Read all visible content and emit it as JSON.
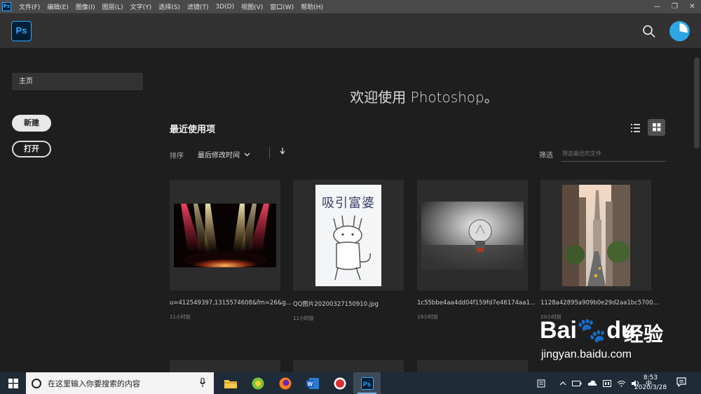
{
  "menubar": {
    "app_icon": "Ps",
    "items": [
      "文件(F)",
      "编辑(E)",
      "图像(I)",
      "图层(L)",
      "文字(Y)",
      "选择(S)",
      "滤镜(T)",
      "3D(D)",
      "视图(V)",
      "窗口(W)",
      "帮助(H)"
    ],
    "window_controls": [
      "—",
      "❐",
      "✕"
    ]
  },
  "header": {
    "logo": "Ps",
    "search_icon": "search-icon",
    "avatar_icon": "user-avatar"
  },
  "sidebar": {
    "home_label": "主页",
    "new_button": "新建",
    "open_button": "打开"
  },
  "main": {
    "welcome": "欢迎使用 Photoshop。",
    "recent_title": "最近使用项",
    "sort_label": "排序",
    "sort_value": "最后修改时间",
    "sort_direction_icon": "arrow-down-icon",
    "filter_label": "筛选",
    "filter_placeholder": "筛选最近的文件",
    "files": [
      {
        "name": "u=412549397,1315574608&fm=26&g...",
        "time": "11小时前",
        "thumb": "stage-lights"
      },
      {
        "name": "QQ图片20200327150910.jpg",
        "time": "11小时前",
        "thumb": "cat-meme",
        "thumb_text": "吸引富婆"
      },
      {
        "name": "1c55bbe4aa4dd04f159fd7e46174aa1...",
        "time": "19小时前",
        "thumb": "light-bulb"
      },
      {
        "name": "1128a42895a909b0e29d2aa1bc5700...",
        "time": "20小时前",
        "thumb": "city-street"
      }
    ]
  },
  "watermark": {
    "brand": "Bai",
    "brand2": "du",
    "cn": "经验",
    "url": "jingyan.baidu.com"
  },
  "taskbar": {
    "search_placeholder": "在这里输入你要搜索的内容",
    "time": "8:53",
    "date": "2020/3/28",
    "tray_text": "中"
  },
  "colors": {
    "ps_blue": "#31a8ff",
    "ps_dark": "#001e36",
    "background": "#1e1e1e"
  }
}
